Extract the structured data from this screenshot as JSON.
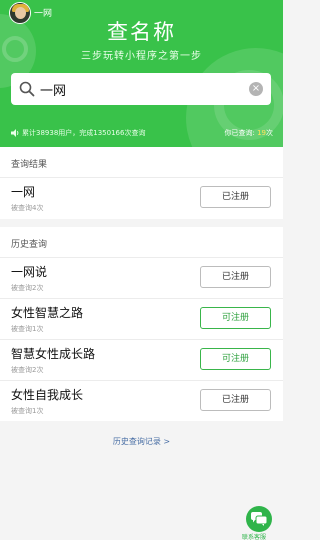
{
  "header": {
    "user_name": "一网",
    "title": "查名称",
    "subtitle": "三步玩转小程序之第一步",
    "search_value": "一网",
    "stats": "累计38938用户，完成1350166次查询",
    "queried_prefix": "你已查询: ",
    "queried_count": "19",
    "queried_suffix": "次"
  },
  "result": {
    "section_title": "查询结果",
    "items": [
      {
        "name": "一网",
        "count": "被查询4次",
        "status": "已注册",
        "registrable": false
      }
    ]
  },
  "history": {
    "section_title": "历史查询",
    "items": [
      {
        "name": "一网说",
        "count": "被查询2次",
        "status": "已注册",
        "registrable": false
      },
      {
        "name": "女性智慧之路",
        "count": "被查询1次",
        "status": "可注册",
        "registrable": true
      },
      {
        "name": "智慧女性成长路",
        "count": "被查询2次",
        "status": "可注册",
        "registrable": true
      },
      {
        "name": "女性自我成长",
        "count": "被查询1次",
        "status": "已注册",
        "registrable": false
      }
    ],
    "link": "历史查询记录 >"
  },
  "contact": {
    "label": "联系客服"
  },
  "colors": {
    "brand": "#39c24a",
    "free_button": "#39b54a"
  }
}
